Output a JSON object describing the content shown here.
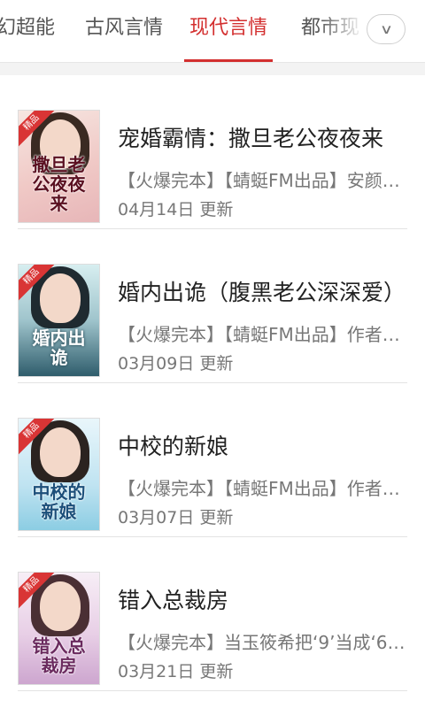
{
  "tabs": [
    {
      "label": "幻超能"
    },
    {
      "label": "古风言情"
    },
    {
      "label": "现代言情"
    },
    {
      "label": "都市现"
    }
  ],
  "active_tab": "现代言情",
  "colors": {
    "accent": "#d32f2f",
    "badge": "#d93535"
  },
  "books": [
    {
      "title": "宠婚霸情：撒旦老公夜夜来",
      "desc": "【火爆完本】【蜻蜓FM出品】安颜…",
      "date": "04月14日 更新",
      "badge": "精品",
      "cover_text": "撒旦老公夜夜来"
    },
    {
      "title": "婚内出诡（腹黑老公深深爱）",
      "desc": "【火爆完本】【蜻蜓FM出品】作者…",
      "date": "03月09日 更新",
      "badge": "精品",
      "cover_text": "婚内出诡"
    },
    {
      "title": "中校的新娘",
      "desc": "【火爆完本】【蜻蜓FM出品】作者…",
      "date": "03月07日 更新",
      "badge": "精品",
      "cover_text": "中校的新娘"
    },
    {
      "title": "错入总裁房",
      "desc": "【火爆完本】当玉筱希把‘9’当成‘6’…",
      "date": "03月21日 更新",
      "badge": "精品",
      "cover_text": "错入总裁房"
    }
  ]
}
